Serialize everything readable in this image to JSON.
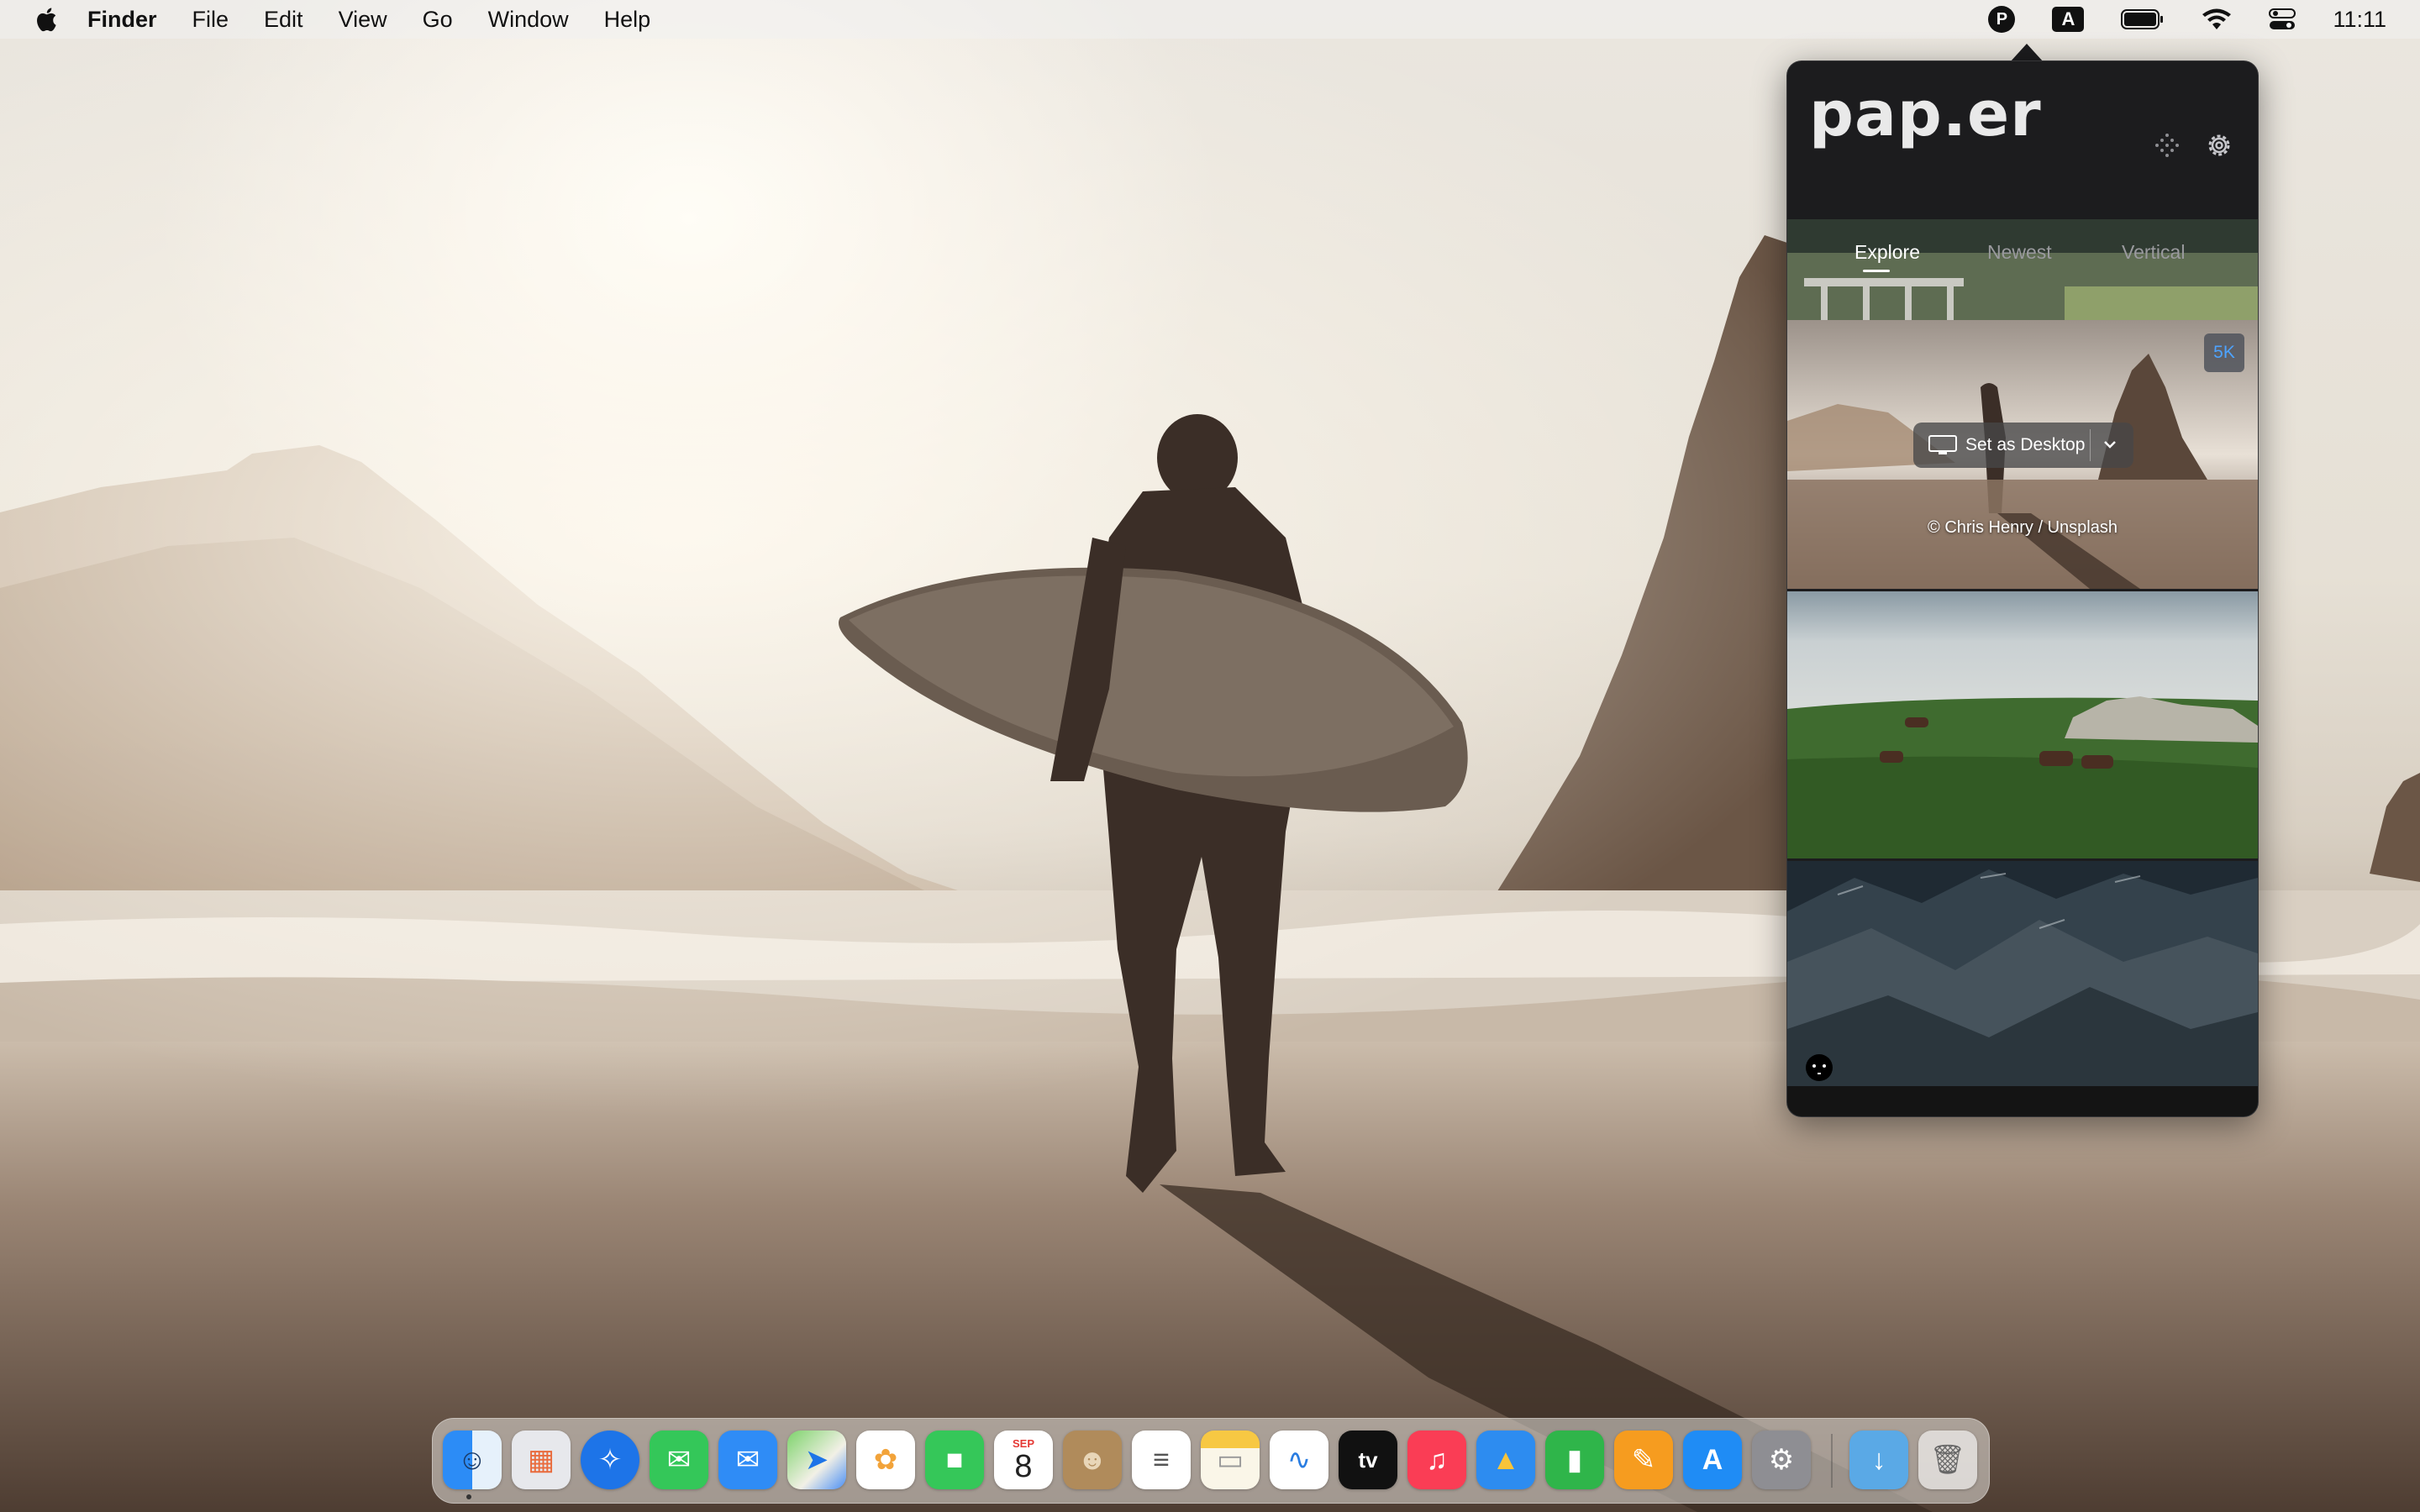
{
  "menubar": {
    "apple": "apple-icon",
    "app_name": "Finder",
    "items": [
      "File",
      "Edit",
      "View",
      "Go",
      "Window",
      "Help"
    ],
    "status": {
      "paper_icon_letter": "P",
      "input_source_letter": "A",
      "clock": "11:11"
    }
  },
  "paper": {
    "logo": "pap.er",
    "tabs": [
      {
        "label": "Explore",
        "active": true
      },
      {
        "label": "Newest",
        "active": false
      },
      {
        "label": "Vertical",
        "active": false
      }
    ],
    "wallpapers": [
      {
        "id": "beach",
        "badge": "5K",
        "action_label": "Set as Desktop",
        "credit": "© Chris Henry / Unsplash"
      }
    ]
  },
  "dock": {
    "apps": [
      {
        "name": "Finder",
        "glyph": "☺"
      },
      {
        "name": "Launchpad",
        "glyph": "▦"
      },
      {
        "name": "Safari",
        "glyph": "✧"
      },
      {
        "name": "Messages",
        "glyph": "✉"
      },
      {
        "name": "Mail",
        "glyph": "✉"
      },
      {
        "name": "Maps",
        "glyph": "➤"
      },
      {
        "name": "Photos",
        "glyph": "✿"
      },
      {
        "name": "FaceTime",
        "glyph": "■"
      },
      {
        "name": "Calendar",
        "month": "SEP",
        "day": "8"
      },
      {
        "name": "Contacts",
        "glyph": "☻"
      },
      {
        "name": "Reminders",
        "glyph": "≡"
      },
      {
        "name": "Notes",
        "glyph": "▭"
      },
      {
        "name": "Freeform",
        "glyph": "∿"
      },
      {
        "name": "TV",
        "glyph": "tv"
      },
      {
        "name": "Music",
        "glyph": "♫"
      },
      {
        "name": "Keynote",
        "glyph": "▲"
      },
      {
        "name": "Numbers",
        "glyph": "▮"
      },
      {
        "name": "Pages",
        "glyph": "✎"
      },
      {
        "name": "App Store",
        "glyph": "A"
      },
      {
        "name": "System Settings",
        "glyph": "⚙"
      }
    ],
    "downloads": {
      "name": "Downloads",
      "glyph": "↓"
    },
    "trash": {
      "name": "Trash",
      "glyph": "🗑"
    }
  },
  "colors": {
    "popover_bg": "#1c1c1e",
    "badge_text": "#4da3ff",
    "tab_active": "#ffffff",
    "tab_inactive": "#9a9a9e"
  }
}
